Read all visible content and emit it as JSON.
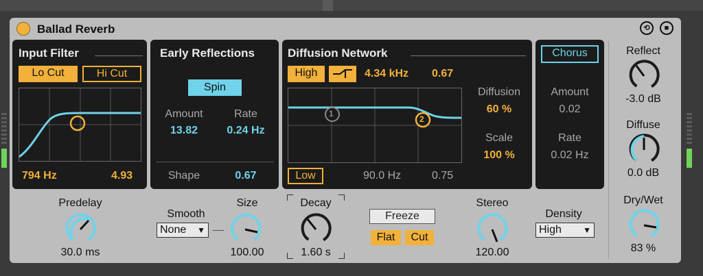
{
  "device": {
    "title": "Ballad Reverb",
    "power_on": true
  },
  "input_filter": {
    "title": "Input Filter",
    "lo_cut_label": "Lo Cut",
    "hi_cut_label": "Hi Cut",
    "frequency": "794 Hz",
    "width": "4.93"
  },
  "early_reflections": {
    "title": "Early Reflections",
    "spin_label": "Spin",
    "amount_label": "Amount",
    "amount_value": "13.82",
    "rate_label": "Rate",
    "rate_value": "0.24 Hz",
    "shape_label": "Shape",
    "shape_value": "0.67"
  },
  "diffusion_network": {
    "title": "Diffusion Network",
    "high_label": "High",
    "high_freq": "4.34 kHz",
    "high_value": "0.67",
    "diffusion_label": "Diffusion",
    "diffusion_value": "60 %",
    "scale_label": "Scale",
    "scale_value": "100 %",
    "low_label": "Low",
    "low_freq": "90.0 Hz",
    "low_value": "0.75",
    "point1": "1",
    "point2": "2"
  },
  "chorus": {
    "title": "Chorus",
    "amount_label": "Amount",
    "amount_value": "0.02",
    "rate_label": "Rate",
    "rate_value": "0.02 Hz"
  },
  "global": {
    "predelay_label": "Predelay",
    "predelay_value": "30.0 ms",
    "smooth_label": "Smooth",
    "smooth_value": "None",
    "size_label": "Size",
    "size_value": "100.00",
    "decay_label": "Decay",
    "decay_value": "1.60 s",
    "freeze_label": "Freeze",
    "flat_label": "Flat",
    "cut_label": "Cut",
    "stereo_label": "Stereo",
    "stereo_value": "120.00",
    "density_label": "Density",
    "density_value": "High"
  },
  "output": {
    "reflect_label": "Reflect",
    "reflect_value": "-3.0 dB",
    "diffuse_label": "Diffuse",
    "diffuse_value": "0.0 dB",
    "drywet_label": "Dry/Wet",
    "drywet_value": "83 %"
  },
  "colors": {
    "accent_orange": "#f2b13a",
    "accent_blue": "#6fd3ea",
    "panel_bg": "#1b1b1b",
    "device_bg": "#bdbdbd"
  }
}
